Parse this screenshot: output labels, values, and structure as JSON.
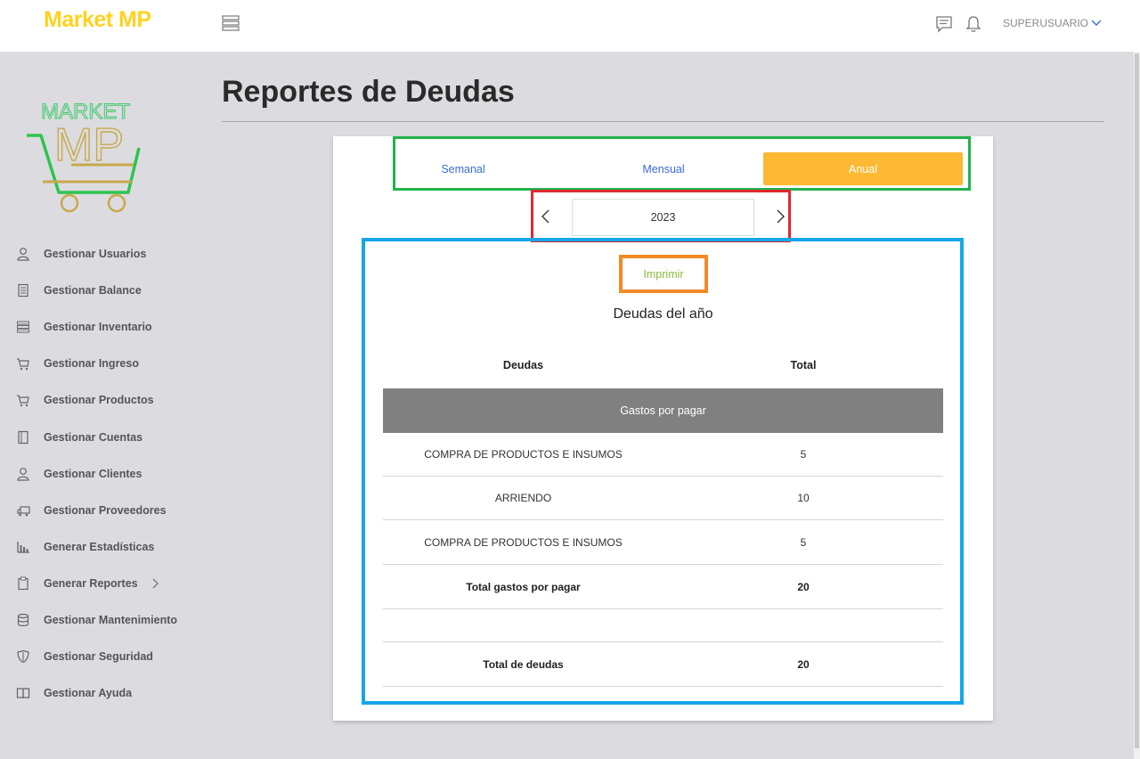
{
  "header": {
    "brand": "Market MP",
    "user": "SUPERUSUARIO"
  },
  "sidebar": {
    "logo_text_top": "MARKET",
    "logo_text_bottom": "MP",
    "items": [
      {
        "label": "Gestionar Usuarios",
        "icon": "user-icon"
      },
      {
        "label": "Gestionar Balance",
        "icon": "document-icon"
      },
      {
        "label": "Gestionar Inventario",
        "icon": "list-icon"
      },
      {
        "label": "Gestionar Ingreso",
        "icon": "cart-icon"
      },
      {
        "label": "Gestionar Productos",
        "icon": "cart-icon"
      },
      {
        "label": "Gestionar Cuentas",
        "icon": "book-icon"
      },
      {
        "label": "Gestionar Clientes",
        "icon": "user-icon"
      },
      {
        "label": "Gestionar Proveedores",
        "icon": "truck-icon"
      },
      {
        "label": "Generar Estadísticas",
        "icon": "bar-chart-icon"
      },
      {
        "label": "Generar Reportes",
        "icon": "clipboard-icon"
      },
      {
        "label": "Gestionar Mantenimiento",
        "icon": "database-icon"
      },
      {
        "label": "Gestionar Seguridad",
        "icon": "shield-icon"
      },
      {
        "label": "Gestionar Ayuda",
        "icon": "open-book-icon"
      }
    ]
  },
  "page": {
    "title": "Reportes de Deudas"
  },
  "tabs": {
    "semanal": "Semanal",
    "mensual": "Mensual",
    "anual": "Anual",
    "active": "Anual"
  },
  "year_selector": {
    "value": "2023"
  },
  "report": {
    "print_label": "Imprimir",
    "title": "Deudas del año",
    "columns": [
      "Deudas",
      "Total"
    ],
    "section_title": "Gastos por pagar",
    "rows": [
      {
        "name": "COMPRA DE PRODUCTOS E INSUMOS",
        "total": "5"
      },
      {
        "name": "ARRIENDO",
        "total": "10"
      },
      {
        "name": "COMPRA DE PRODUCTOS E INSUMOS",
        "total": "5"
      }
    ],
    "subtotal_label": "Total gastos por pagar",
    "subtotal_value": "20",
    "grand_total_label": "Total de deudas",
    "grand_total_value": "20"
  },
  "colors": {
    "brand": "#ffd21f",
    "active_tab": "#fdb934",
    "tab_link": "#3a6bd9",
    "print_text": "#8cbb3f",
    "section_header": "#808080"
  }
}
